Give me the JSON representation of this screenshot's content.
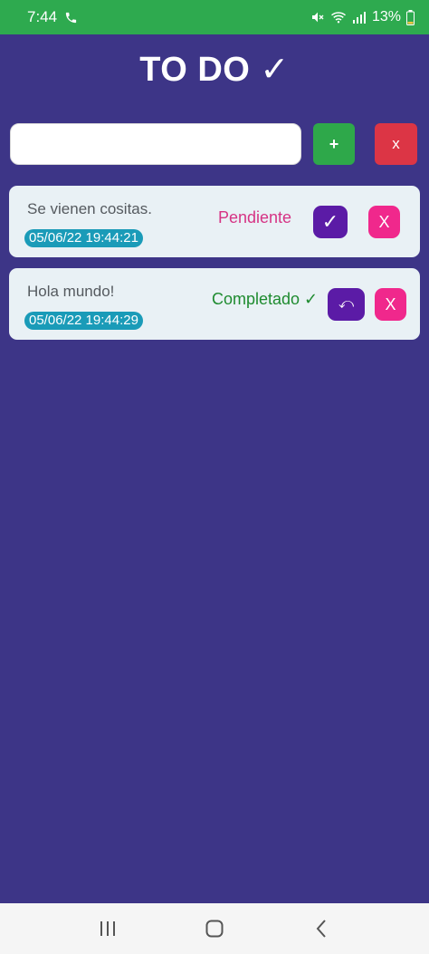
{
  "status_bar": {
    "time": "7:44",
    "battery": "13%",
    "icons": [
      "phone-call-icon",
      "mute-icon",
      "wifi-icon",
      "signal-icon",
      "battery-icon"
    ]
  },
  "app": {
    "title": "TO DO ✓"
  },
  "new_task": {
    "value": "",
    "placeholder": "",
    "add_label": "+",
    "clear_label": "x"
  },
  "tasks": [
    {
      "text": "Se vienen cositas.",
      "date": "05/06/22 19:44:21",
      "status": "Pendiente",
      "action_label": "✓",
      "delete_label": "X"
    },
    {
      "text": "Hola mundo!",
      "date": "05/06/22 19:44:29",
      "status": "Completado ✓",
      "action_label": "⤺",
      "delete_label": "X"
    }
  ],
  "nav": {
    "icons": [
      "recent-apps-icon",
      "home-icon",
      "back-icon"
    ]
  },
  "colors": {
    "background": "#3d3587",
    "status_bar": "#2eaa4f",
    "add": "#2ea84a",
    "clear": "#dc3545",
    "card": "#e9f1f5",
    "date_badge": "#1a9bb8",
    "pending": "#d63384",
    "completed": "#1e8b2f",
    "action_button": "#5b1ba6",
    "delete_button": "#f0288c"
  }
}
